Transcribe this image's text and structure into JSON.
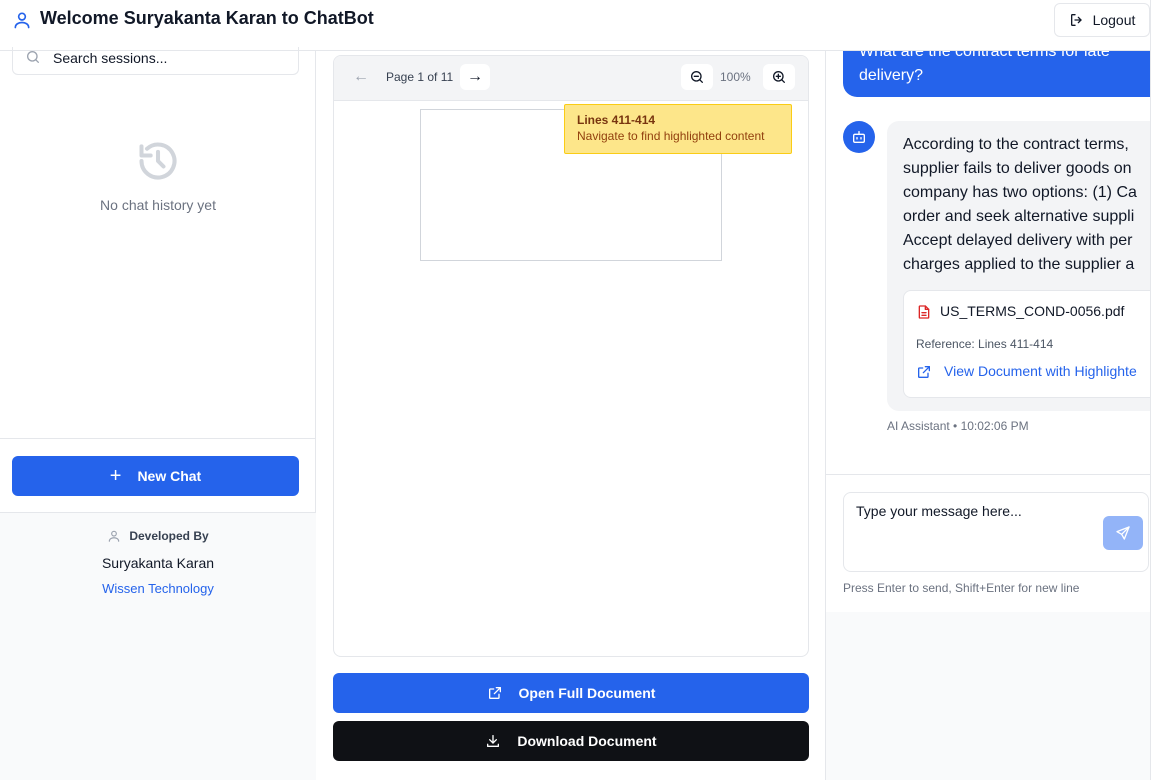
{
  "header": {
    "title": "Welcome Suryakanta Karan to ChatBot",
    "logout_label": "Logout",
    "icons": {
      "user": "user-icon",
      "logout": "logout-icon"
    }
  },
  "sidebar": {
    "search_placeholder": "Search sessions...",
    "empty_text": "No chat history yet",
    "new_chat_label": "New Chat",
    "developed_by_label": "Developed By",
    "developer_name": "Suryakanta Karan",
    "company": "Wissen Technology"
  },
  "viewer": {
    "prev_arrow": "←",
    "next_arrow": "→",
    "page_label": "Page 1 of 11",
    "zoom_level": "100%",
    "highlight": {
      "title": "Lines 411-414",
      "subtitle": "Navigate to find highlighted content"
    },
    "open_full_label": "Open Full Document",
    "download_label": "Download Document"
  },
  "chat": {
    "user_message": "What are the contract terms for late\ndelivery?",
    "bot_message": "According to the contract terms,\nsupplier fails to deliver goods on\ncompany has two options: (1) Ca\norder and seek alternative suppli\nAccept delayed delivery with per\ncharges applied to the supplier a",
    "reference": {
      "file_name": "US_TERMS_COND-0056.pdf",
      "reference_text": "Reference: Lines 411-414",
      "link_text": "View Document with Highlighte"
    },
    "meta": "AI Assistant • 10:02:06 PM",
    "input_placeholder": "Type your message here...",
    "hint": "Press Enter to send, Shift+Enter for new line"
  },
  "colors": {
    "accent": "#2563eb",
    "dark_button": "#0f1115",
    "highlight_bg": "#fde68a",
    "send_disabled": "#93b4f8"
  }
}
